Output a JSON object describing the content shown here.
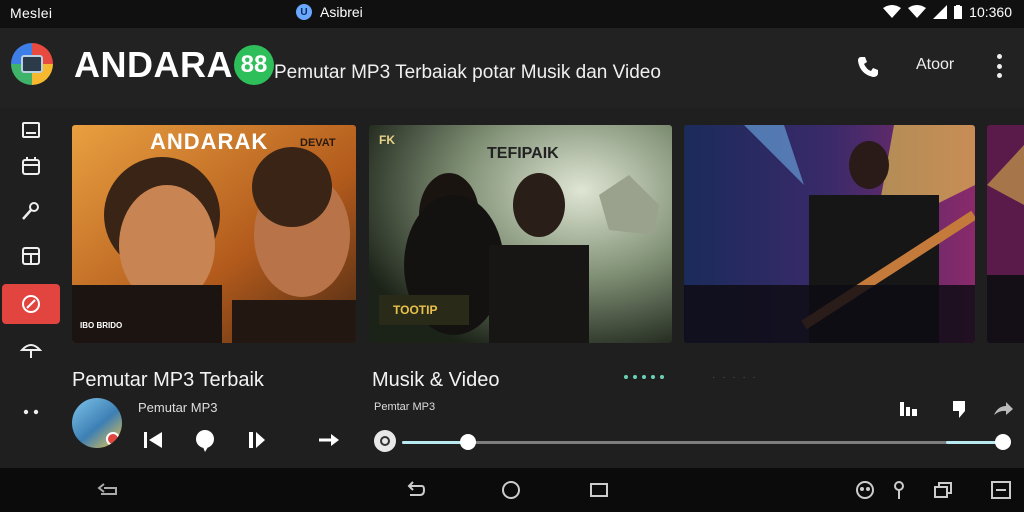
{
  "status_bar": {
    "carrier": "Meslei",
    "center_badge": "U",
    "center_label": "Asibrei",
    "time": "10:360"
  },
  "header": {
    "brand_name": "ANDARA",
    "brand_badge": "88",
    "tagline": "Pemutar MP3 Terbaiak potar Musik dan Video",
    "about_label": "Atoor"
  },
  "cards": [
    {
      "title": "ANDARAK",
      "corner_text": "DEVAT",
      "footer_text": "IBO BRIDO"
    },
    {
      "title": "TEFIPAIK",
      "corner_text": "FK",
      "footer_text": "TOOTIP"
    },
    {
      "title": "",
      "corner_text": "",
      "footer_text": ""
    }
  ],
  "player": {
    "section_title": "Pemutar MP3 Terbaik",
    "now_playing_sub": "Pemutar MP3"
  },
  "video": {
    "section_title": "Musik & Video",
    "sub": "Pemtar MP3",
    "pager_faint": "·  ·  ·  ·  ·"
  },
  "icons": {
    "sidebar": [
      "list-icon",
      "calendar-icon",
      "wrench-icon",
      "grid-icon",
      "compass-icon",
      "umbrella-icon",
      "more-icon"
    ],
    "right_controls": [
      "equalizer-icon",
      "bookmark-icon",
      "share-icon"
    ],
    "nav": [
      "back-left-icon",
      "back-icon",
      "home-icon",
      "recents-icon",
      "people-icon",
      "location-icon",
      "window-icon",
      "minus-icon"
    ]
  },
  "progress": {
    "value": 0.11
  },
  "colors": {
    "accent_red": "#e2443f",
    "accent_green": "#2fbf5a",
    "seek_fill": "#b8e8f0"
  }
}
